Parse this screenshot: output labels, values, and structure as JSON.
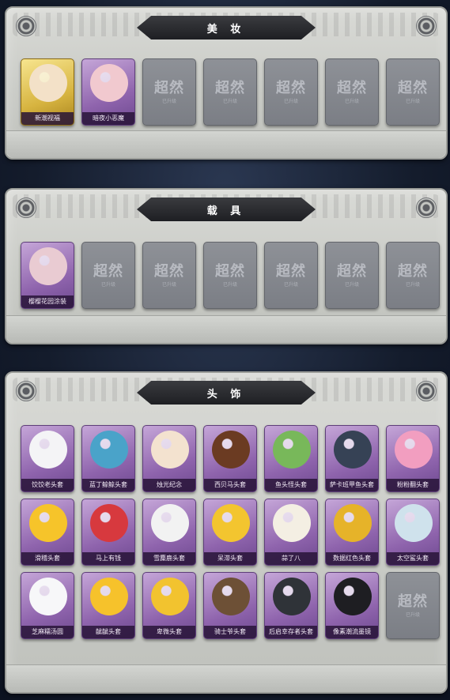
{
  "sections": [
    {
      "title": "美 妆",
      "items": [
        {
          "label": "新潮视福",
          "style": "gold",
          "art": "#f3e1c8"
        },
        {
          "label": "暗夜小恶魔",
          "style": "purple",
          "art": "#f1c9cf"
        },
        {
          "empty": true
        },
        {
          "empty": true
        },
        {
          "empty": true
        },
        {
          "empty": true
        },
        {
          "empty": true
        }
      ]
    },
    {
      "title": "载 具",
      "items": [
        {
          "label": "樱樱花园涂装",
          "style": "purple",
          "art": "#e9cbd2"
        },
        {
          "empty": true
        },
        {
          "empty": true
        },
        {
          "empty": true
        },
        {
          "empty": true
        },
        {
          "empty": true
        },
        {
          "empty": true
        }
      ]
    },
    {
      "title": "头 饰",
      "items": [
        {
          "label": "饺饺老头套",
          "style": "purple",
          "art": "#f4f4f6"
        },
        {
          "label": "蓝丁鲸鲸头套",
          "style": "purple",
          "art": "#4aa3c9"
        },
        {
          "label": "烛光纪念",
          "style": "purple",
          "art": "#f3e2cf"
        },
        {
          "label": "西贝马头套",
          "style": "purple",
          "art": "#6b3b22"
        },
        {
          "label": "鱼头怪头套",
          "style": "purple",
          "art": "#78b85a"
        },
        {
          "label": "萨卡班甲鱼头套",
          "style": "purple",
          "art": "#364255"
        },
        {
          "label": "粉粉翻头套",
          "style": "purple",
          "art": "#f29ec0"
        },
        {
          "label": "滑稽头套",
          "style": "purple",
          "art": "#f6c42a"
        },
        {
          "label": "马上有钱",
          "style": "purple",
          "art": "#d7393e"
        },
        {
          "label": "雪麋鹿头套",
          "style": "purple",
          "art": "#f2f2f2"
        },
        {
          "label": "呆滞头套",
          "style": "purple",
          "art": "#f3c52f"
        },
        {
          "label": "蒜了八",
          "style": "purple",
          "art": "#f4efe3"
        },
        {
          "label": "数据红色头套",
          "style": "purple",
          "art": "#e6b329"
        },
        {
          "label": "太空鲨头套",
          "style": "purple",
          "art": "#cfe2ec"
        },
        {
          "label": "芝麻糯汤圆",
          "style": "purple",
          "art": "#f7f7f9"
        },
        {
          "label": "龇龇头套",
          "style": "purple",
          "art": "#f6c22b"
        },
        {
          "label": "卑微头套",
          "style": "purple",
          "art": "#f2c32f"
        },
        {
          "label": "骑士爷头套",
          "style": "purple",
          "art": "#6d5036"
        },
        {
          "label": "后启幸存者头套",
          "style": "purple",
          "art": "#2f3338"
        },
        {
          "label": "像素潮流墨镜",
          "style": "purple",
          "art": "#1e1e22"
        },
        {
          "empty": true
        }
      ]
    }
  ],
  "empty_watermark": {
    "main": "超然",
    "sub": "已升级"
  }
}
